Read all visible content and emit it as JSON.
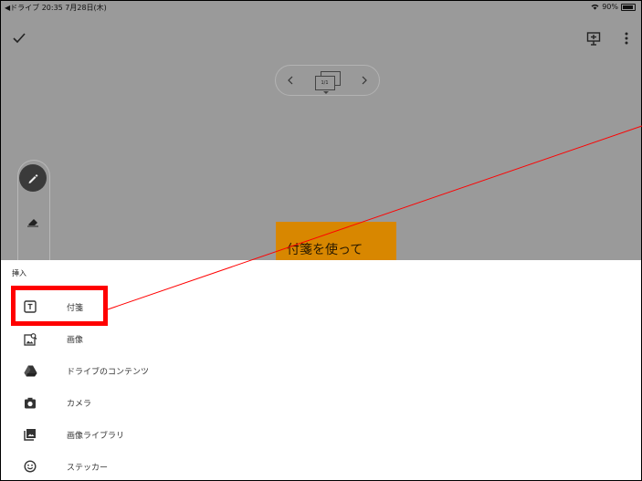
{
  "status_bar": {
    "left_text": "◀ドライブ  20:35  7月28日(木)",
    "battery_text": "90%"
  },
  "toolbar": {
    "done_icon": "check-icon",
    "present_icon": "present-icon",
    "more_icon": "more-vert-icon"
  },
  "page_nav": {
    "page_indicator": "1/1"
  },
  "canvas": {
    "sticky_text": "付箋を使って"
  },
  "insert_sheet": {
    "title": "挿入",
    "items": [
      {
        "label": "付箋",
        "icon": "sticky-note-icon"
      },
      {
        "label": "画像",
        "icon": "image-search-icon"
      },
      {
        "label": "ドライブのコンテンツ",
        "icon": "drive-icon"
      },
      {
        "label": "カメラ",
        "icon": "camera-icon"
      },
      {
        "label": "画像ライブラリ",
        "icon": "photo-library-icon"
      },
      {
        "label": "ステッカー",
        "icon": "sticker-icon"
      }
    ]
  },
  "colors": {
    "background_overlay": "#9a9a9a",
    "sticky": "#d88700",
    "highlight": "#ff0000"
  }
}
